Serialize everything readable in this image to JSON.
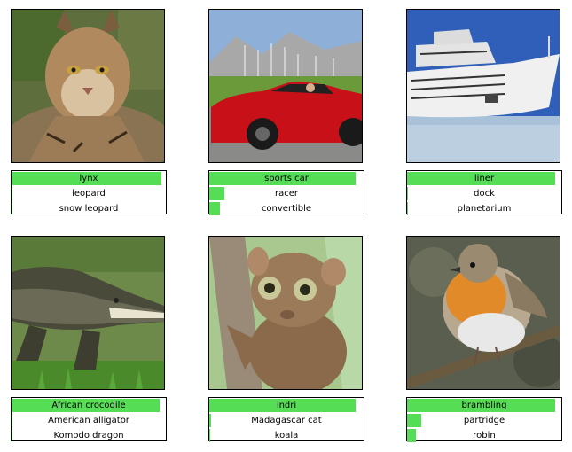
{
  "chart_data": {
    "type": "bar",
    "panels": [
      {
        "image": "lynx photo",
        "predictions": [
          {
            "label": "lynx",
            "score": 0.97
          },
          {
            "label": "leopard",
            "score": 0.005
          },
          {
            "label": "snow leopard",
            "score": 0.004
          }
        ]
      },
      {
        "image": "red sports car photo",
        "predictions": [
          {
            "label": "sports car",
            "score": 0.95
          },
          {
            "label": "racer",
            "score": 0.1
          },
          {
            "label": "convertible",
            "score": 0.07
          }
        ]
      },
      {
        "image": "cruise ship photo",
        "predictions": [
          {
            "label": "liner",
            "score": 0.96
          },
          {
            "label": "dock",
            "score": 0.004
          },
          {
            "label": "planetarium",
            "score": 0.003
          }
        ]
      },
      {
        "image": "crocodile photo",
        "predictions": [
          {
            "label": "African crocodile",
            "score": 0.96
          },
          {
            "label": "American alligator",
            "score": 0.004
          },
          {
            "label": "Komodo dragon",
            "score": 0.003
          }
        ]
      },
      {
        "image": "tarsier photo",
        "predictions": [
          {
            "label": "indri",
            "score": 0.95
          },
          {
            "label": "Madagascar cat",
            "score": 0.01
          },
          {
            "label": "koala",
            "score": 0.004
          }
        ]
      },
      {
        "image": "robin bird photo",
        "predictions": [
          {
            "label": "brambling",
            "score": 0.96
          },
          {
            "label": "partridge",
            "score": 0.09
          },
          {
            "label": "robin",
            "score": 0.06
          }
        ]
      }
    ],
    "bar_color": "#55dd55",
    "xlim": [
      0,
      1
    ]
  }
}
